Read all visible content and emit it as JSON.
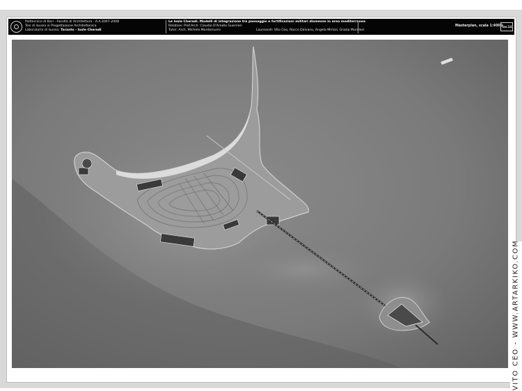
{
  "titleblock": {
    "institution": "Politecnico di Bari - Facoltà di Architettura - A.A.2007-2008",
    "thesis": "Tesi di laurea in Progettazione Architettonica",
    "lab_prefix": "Laboratorio di laurea:",
    "lab_title": "Taranto - Isole Cheradi",
    "project_prefix": "Le Isole Cheradi.",
    "project_title": "Modelli di integrazione tra paesaggio e fortificazioni militari dismesse in area mediterranea",
    "relatore": "Relatore: Prof.Arch. Claudio D'Amato Guerrieri",
    "tutor": "Tutor: Arch. Michele Montemurro",
    "laureandi": "Laureandi: Vito Ceo, Rocco Dalvano, Angela Mirizzi, Grazia Murolesi",
    "scale": "Masterplan, scala 1:4000",
    "sheet": "Tav.14"
  },
  "caption": "VITO CEO - WWW.ARTARKIKO.COM",
  "colors": {
    "titlebar": "#050505",
    "sea": "#777777",
    "island": "#9c9c9c",
    "beach": "#dcdcdc"
  }
}
